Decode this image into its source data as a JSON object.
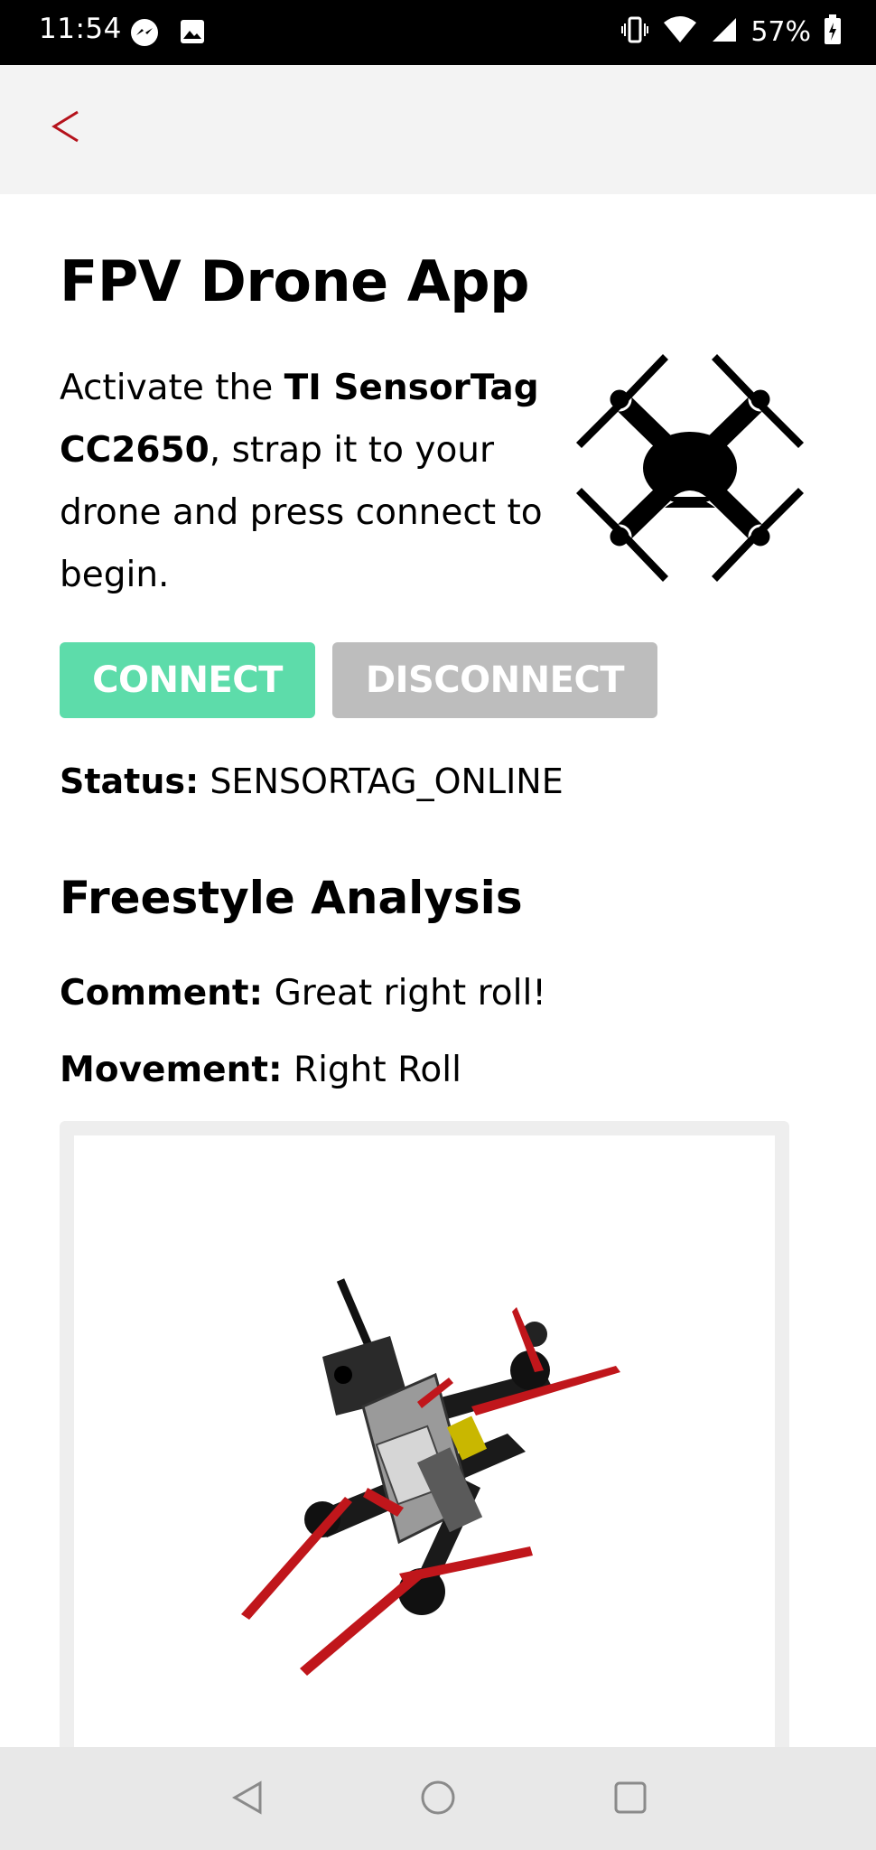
{
  "status_bar": {
    "time": "11:54",
    "battery": "57%",
    "icons": [
      "messenger-icon",
      "image-icon",
      "vibrate-icon",
      "wifi-icon",
      "signal-icon",
      "battery-icon"
    ]
  },
  "app_bar": {
    "back_icon": "chevron-left-icon",
    "accent": "#b5121b"
  },
  "main": {
    "title": "FPV Drone App",
    "intro": {
      "text1": "Activate the ",
      "bold1": "TI SensorTag CC2650",
      "text2": ", strap it to your drone and press connect to begin."
    },
    "buttons": {
      "connect": "CONNECT",
      "disconnect": "DISCONNECT"
    },
    "status": {
      "label": "Status:",
      "value": "SENSORTAG_ONLINE"
    }
  },
  "analysis": {
    "title": "Freestyle Analysis",
    "comment": {
      "label": "Comment:",
      "value": "Great right roll!"
    },
    "movement": {
      "label": "Movement:",
      "value": "Right Roll"
    }
  },
  "colors": {
    "connect": "#5ddcaa",
    "disconnect": "#bdbdbd",
    "prop": "#c0161b"
  }
}
